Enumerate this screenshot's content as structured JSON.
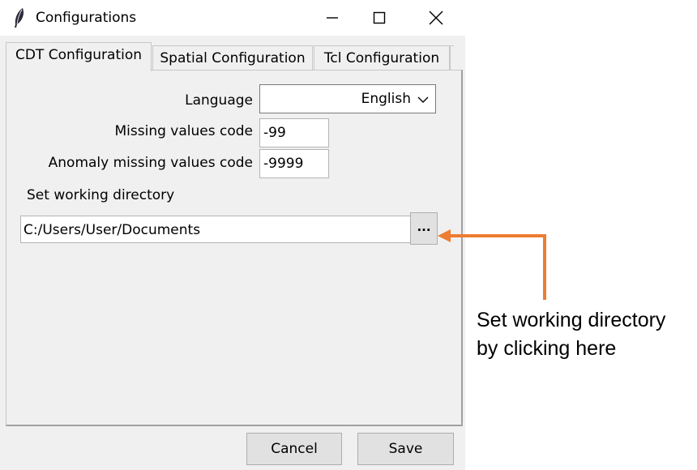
{
  "window": {
    "title": "Configurations",
    "icon": "feather-icon"
  },
  "tabs": [
    {
      "label": "CDT Configuration",
      "active": true
    },
    {
      "label": "Spatial Configuration",
      "active": false
    },
    {
      "label": "Tcl Configuration",
      "active": false
    }
  ],
  "form": {
    "language_label": "Language",
    "language_value": "English",
    "missing_label": "Missing values code",
    "missing_value": "-99",
    "anomaly_label": "Anomaly missing values code",
    "anomaly_value": "-9999",
    "working_dir_label": "Set working directory",
    "working_dir_value": "C:/Users/User/Documents",
    "browse_label": "..."
  },
  "buttons": {
    "cancel": "Cancel",
    "save": "Save"
  },
  "annotation": {
    "line1": "Set working directory",
    "line2": "by clicking here",
    "color": "#ed7d31"
  }
}
